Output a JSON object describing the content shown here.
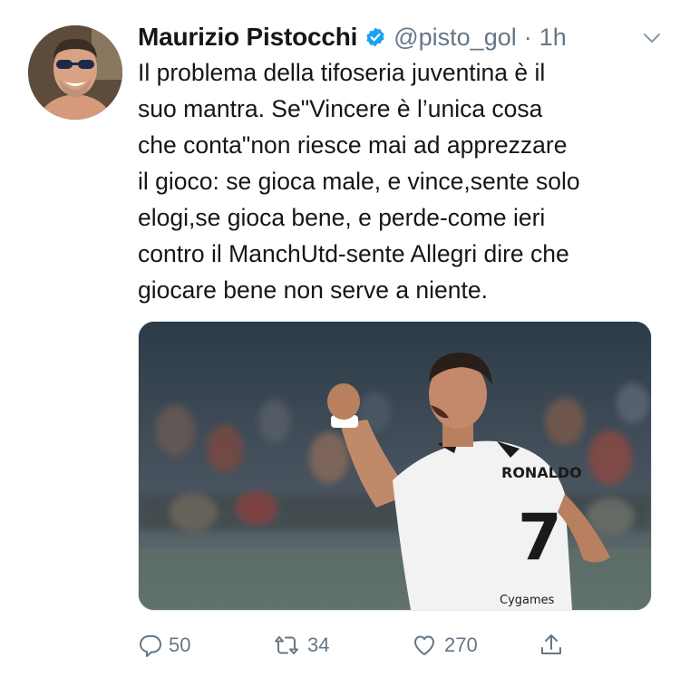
{
  "tweet": {
    "author_name": "Maurizio Pistocchi",
    "handle": "@pisto_gol",
    "separator": "·",
    "time": "1h",
    "text_lines": [
      "Il problema della tifoseria juventina è il",
      "suo mantra. Se\"Vincere è l’unica cosa",
      "che conta\"non riesce mai ad apprezzare",
      "il gioco: se gioca male, e vince,sente solo",
      "elogi,se gioca bene, e perde-come ieri",
      "contro il ManchUtd-sente Allegri dire che",
      "giocare bene non serve a niente."
    ],
    "media": {
      "jersey_name": "RONALDO",
      "jersey_number": "7",
      "sponsor": "Cygames"
    }
  },
  "actions": {
    "reply_count": "50",
    "retweet_count": "34",
    "like_count": "270"
  },
  "icons": {
    "verified": "verified-badge-icon",
    "more": "chevron-down-icon",
    "reply": "reply-icon",
    "retweet": "retweet-icon",
    "like": "heart-icon",
    "share": "share-icon"
  },
  "colors": {
    "verified_blue": "#1da1f2",
    "text_primary": "#14171a",
    "text_secondary": "#657786",
    "border": "#e1e8ed"
  }
}
